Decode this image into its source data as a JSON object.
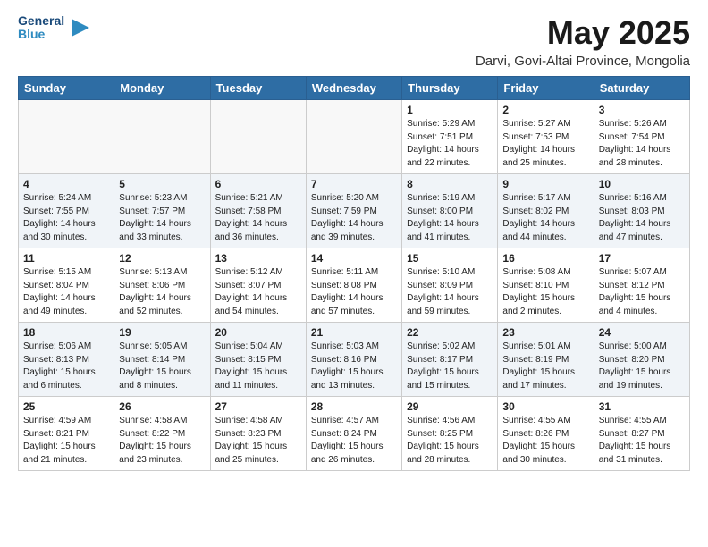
{
  "header": {
    "logo_line1": "General",
    "logo_line2": "Blue",
    "title": "May 2025",
    "subtitle": "Darvi, Govi-Altai Province, Mongolia"
  },
  "columns": [
    "Sunday",
    "Monday",
    "Tuesday",
    "Wednesday",
    "Thursday",
    "Friday",
    "Saturday"
  ],
  "weeks": [
    [
      {
        "day": "",
        "info": ""
      },
      {
        "day": "",
        "info": ""
      },
      {
        "day": "",
        "info": ""
      },
      {
        "day": "",
        "info": ""
      },
      {
        "day": "1",
        "info": "Sunrise: 5:29 AM\nSunset: 7:51 PM\nDaylight: 14 hours\nand 22 minutes."
      },
      {
        "day": "2",
        "info": "Sunrise: 5:27 AM\nSunset: 7:53 PM\nDaylight: 14 hours\nand 25 minutes."
      },
      {
        "day": "3",
        "info": "Sunrise: 5:26 AM\nSunset: 7:54 PM\nDaylight: 14 hours\nand 28 minutes."
      }
    ],
    [
      {
        "day": "4",
        "info": "Sunrise: 5:24 AM\nSunset: 7:55 PM\nDaylight: 14 hours\nand 30 minutes."
      },
      {
        "day": "5",
        "info": "Sunrise: 5:23 AM\nSunset: 7:57 PM\nDaylight: 14 hours\nand 33 minutes."
      },
      {
        "day": "6",
        "info": "Sunrise: 5:21 AM\nSunset: 7:58 PM\nDaylight: 14 hours\nand 36 minutes."
      },
      {
        "day": "7",
        "info": "Sunrise: 5:20 AM\nSunset: 7:59 PM\nDaylight: 14 hours\nand 39 minutes."
      },
      {
        "day": "8",
        "info": "Sunrise: 5:19 AM\nSunset: 8:00 PM\nDaylight: 14 hours\nand 41 minutes."
      },
      {
        "day": "9",
        "info": "Sunrise: 5:17 AM\nSunset: 8:02 PM\nDaylight: 14 hours\nand 44 minutes."
      },
      {
        "day": "10",
        "info": "Sunrise: 5:16 AM\nSunset: 8:03 PM\nDaylight: 14 hours\nand 47 minutes."
      }
    ],
    [
      {
        "day": "11",
        "info": "Sunrise: 5:15 AM\nSunset: 8:04 PM\nDaylight: 14 hours\nand 49 minutes."
      },
      {
        "day": "12",
        "info": "Sunrise: 5:13 AM\nSunset: 8:06 PM\nDaylight: 14 hours\nand 52 minutes."
      },
      {
        "day": "13",
        "info": "Sunrise: 5:12 AM\nSunset: 8:07 PM\nDaylight: 14 hours\nand 54 minutes."
      },
      {
        "day": "14",
        "info": "Sunrise: 5:11 AM\nSunset: 8:08 PM\nDaylight: 14 hours\nand 57 minutes."
      },
      {
        "day": "15",
        "info": "Sunrise: 5:10 AM\nSunset: 8:09 PM\nDaylight: 14 hours\nand 59 minutes."
      },
      {
        "day": "16",
        "info": "Sunrise: 5:08 AM\nSunset: 8:10 PM\nDaylight: 15 hours\nand 2 minutes."
      },
      {
        "day": "17",
        "info": "Sunrise: 5:07 AM\nSunset: 8:12 PM\nDaylight: 15 hours\nand 4 minutes."
      }
    ],
    [
      {
        "day": "18",
        "info": "Sunrise: 5:06 AM\nSunset: 8:13 PM\nDaylight: 15 hours\nand 6 minutes."
      },
      {
        "day": "19",
        "info": "Sunrise: 5:05 AM\nSunset: 8:14 PM\nDaylight: 15 hours\nand 8 minutes."
      },
      {
        "day": "20",
        "info": "Sunrise: 5:04 AM\nSunset: 8:15 PM\nDaylight: 15 hours\nand 11 minutes."
      },
      {
        "day": "21",
        "info": "Sunrise: 5:03 AM\nSunset: 8:16 PM\nDaylight: 15 hours\nand 13 minutes."
      },
      {
        "day": "22",
        "info": "Sunrise: 5:02 AM\nSunset: 8:17 PM\nDaylight: 15 hours\nand 15 minutes."
      },
      {
        "day": "23",
        "info": "Sunrise: 5:01 AM\nSunset: 8:19 PM\nDaylight: 15 hours\nand 17 minutes."
      },
      {
        "day": "24",
        "info": "Sunrise: 5:00 AM\nSunset: 8:20 PM\nDaylight: 15 hours\nand 19 minutes."
      }
    ],
    [
      {
        "day": "25",
        "info": "Sunrise: 4:59 AM\nSunset: 8:21 PM\nDaylight: 15 hours\nand 21 minutes."
      },
      {
        "day": "26",
        "info": "Sunrise: 4:58 AM\nSunset: 8:22 PM\nDaylight: 15 hours\nand 23 minutes."
      },
      {
        "day": "27",
        "info": "Sunrise: 4:58 AM\nSunset: 8:23 PM\nDaylight: 15 hours\nand 25 minutes."
      },
      {
        "day": "28",
        "info": "Sunrise: 4:57 AM\nSunset: 8:24 PM\nDaylight: 15 hours\nand 26 minutes."
      },
      {
        "day": "29",
        "info": "Sunrise: 4:56 AM\nSunset: 8:25 PM\nDaylight: 15 hours\nand 28 minutes."
      },
      {
        "day": "30",
        "info": "Sunrise: 4:55 AM\nSunset: 8:26 PM\nDaylight: 15 hours\nand 30 minutes."
      },
      {
        "day": "31",
        "info": "Sunrise: 4:55 AM\nSunset: 8:27 PM\nDaylight: 15 hours\nand 31 minutes."
      }
    ]
  ]
}
